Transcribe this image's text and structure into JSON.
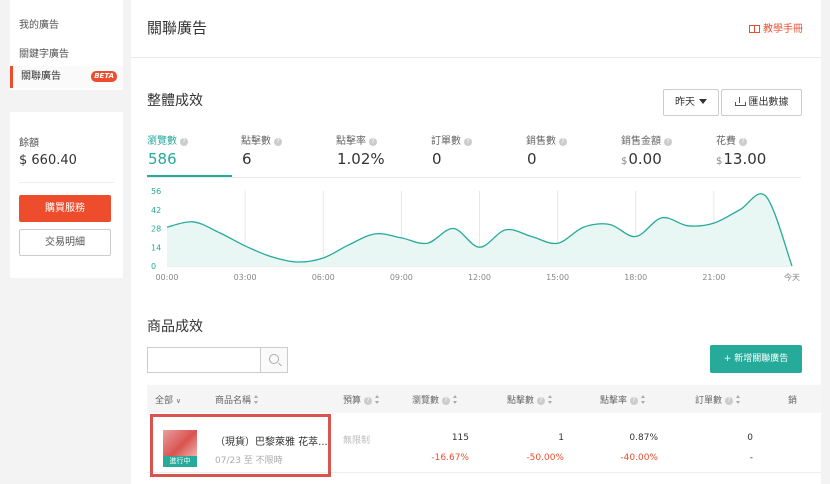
{
  "sidebar": {
    "items": [
      {
        "label": "我的廣告"
      },
      {
        "label": "關鍵字廣告"
      },
      {
        "label": "關聯廣告",
        "badge": "BETA",
        "active": true
      }
    ],
    "balance_label": "餘額",
    "balance_value": "$ 660.40",
    "buy_button": "購買服務",
    "transactions_button": "交易明細"
  },
  "header": {
    "title": "關聯廣告",
    "tutorial": "教學手冊"
  },
  "overall": {
    "title": "整體成效",
    "date_select": "昨天",
    "export_button": "匯出數據",
    "metrics": [
      {
        "label": "瀏覽數",
        "currency": "",
        "value": "586",
        "active": true
      },
      {
        "label": "點擊數",
        "currency": "",
        "value": "6"
      },
      {
        "label": "點擊率",
        "currency": "",
        "value": "1.02%"
      },
      {
        "label": "訂單數",
        "currency": "",
        "value": "0"
      },
      {
        "label": "銷售數",
        "currency": "",
        "value": "0"
      },
      {
        "label": "銷售金額",
        "currency": "$",
        "value": "0.00"
      },
      {
        "label": "花費",
        "currency": "$",
        "value": "13.00"
      }
    ]
  },
  "chart_data": {
    "type": "area",
    "series": [
      {
        "x": [
          0,
          1,
          2,
          3,
          4,
          5,
          6,
          7,
          8,
          9,
          10,
          11,
          12,
          13,
          14,
          15,
          16,
          17,
          18,
          19,
          20,
          21,
          22,
          23,
          24
        ],
        "values": [
          29,
          33,
          25,
          15,
          7,
          3,
          6,
          16,
          24,
          21,
          17,
          28,
          14,
          27,
          22,
          17,
          29,
          31,
          22,
          36,
          30,
          32,
          42,
          52,
          0
        ]
      }
    ],
    "ylim": [
      0,
      56
    ],
    "yticks": [
      "0",
      "14",
      "28",
      "42",
      "56"
    ],
    "xticks": [
      "00:00",
      "03:00",
      "06:00",
      "09:00",
      "12:00",
      "15:00",
      "18:00",
      "21:00",
      "今天"
    ],
    "line_color": "#26aa99",
    "fill_color": "#e8f6f4"
  },
  "products": {
    "title": "商品成效",
    "add_button": "+ 新增關聯廣告",
    "columns": {
      "all": "全部",
      "name": "商品名稱",
      "budget": "預算",
      "views": "瀏覽數",
      "clicks": "點擊數",
      "ctr": "點擊率",
      "orders": "訂單數",
      "sales": "銷"
    },
    "rows": [
      {
        "status": "進行中",
        "name": "（現貨）巴黎萊雅 花萃...",
        "date_range": "07/23 至 不限時",
        "budget": "無限制",
        "views": "115",
        "views_change": "-16.67%",
        "clicks": "1",
        "clicks_change": "-50.00%",
        "ctr": "0.87%",
        "ctr_change": "-40.00%",
        "orders": "0",
        "orders_change": "-"
      }
    ]
  }
}
